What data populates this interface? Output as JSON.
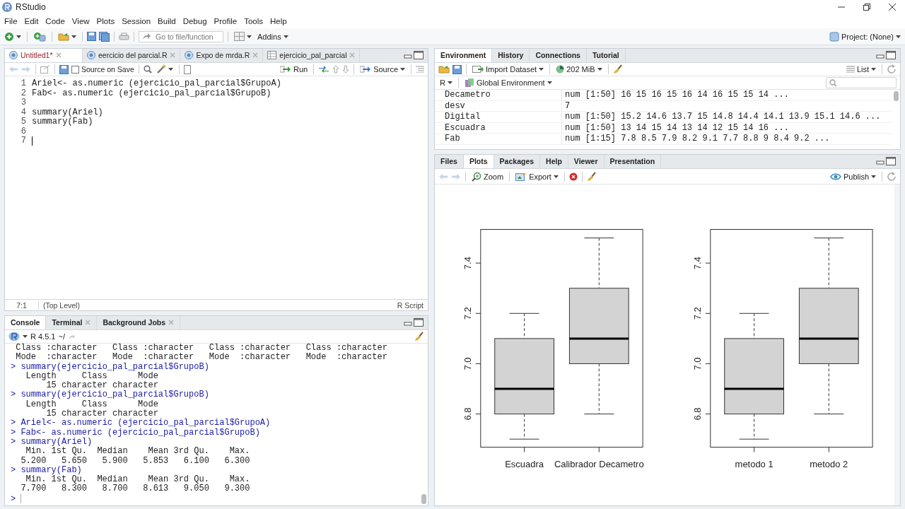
{
  "window": {
    "title": "RStudio"
  },
  "menu": [
    "File",
    "Edit",
    "Code",
    "View",
    "Plots",
    "Session",
    "Build",
    "Debug",
    "Profile",
    "Tools",
    "Help"
  ],
  "toolbar": {
    "goto_placeholder": "Go to file/function",
    "addins": "Addins",
    "project": "Project: (None)"
  },
  "editor": {
    "tabs": [
      {
        "label": "Untitled1*",
        "kind": "script",
        "selected": true,
        "modified": true
      },
      {
        "label": "eercicio del parcial.R",
        "kind": "script",
        "selected": false,
        "modified": false
      },
      {
        "label": "Expo de mrda.R",
        "kind": "script",
        "selected": false,
        "modified": false
      },
      {
        "label": "ejercicio_pal_parcial",
        "kind": "data",
        "selected": false,
        "modified": false
      }
    ],
    "source_on_save": {
      "label": "Source on Save",
      "checked": false
    },
    "run": "Run",
    "source": "Source",
    "lines": [
      {
        "number": "1",
        "code": "Ariel<- as.numeric (ejercicio_pal_parcial$GrupoA)"
      },
      {
        "number": "2",
        "code": "Fab<- as.numeric (ejercicio_pal_parcial$GrupoB)"
      },
      {
        "number": "3"
      },
      {
        "number": "4",
        "code": "summary(Ariel)"
      },
      {
        "number": "5",
        "code": "summary(Fab)"
      },
      {
        "number": "6"
      },
      {
        "number": "7",
        "cursor": true
      }
    ],
    "position": "7:1",
    "scope": "(Top Level)",
    "file_type": "R Script"
  },
  "console": {
    "tabs": [
      {
        "label": "Console",
        "selected": true,
        "closable": false
      },
      {
        "label": "Terminal",
        "selected": false,
        "closable": true
      },
      {
        "label": "Background Jobs",
        "selected": false,
        "closable": true
      }
    ],
    "version": "R 4.5.1",
    "path": "~/",
    "lines": [
      {
        "kind": "output",
        "text": " Class :character   Class :character   Class :character   Class :character"
      },
      {
        "kind": "output",
        "text": " Mode  :character   Mode  :character   Mode  :character   Mode  :character"
      },
      {
        "kind": "input",
        "prompt": ">",
        "text": "summary(ejercicio_pal_parcial$GrupoB)"
      },
      {
        "kind": "output",
        "text": "   Length     Class      Mode"
      },
      {
        "kind": "output",
        "text": "       15 character character"
      },
      {
        "kind": "input",
        "prompt": ">",
        "text": "summary(ejercicio_pal_parcial$GrupoB)"
      },
      {
        "kind": "output",
        "text": "   Length     Class      Mode"
      },
      {
        "kind": "output",
        "text": "       15 character character"
      },
      {
        "kind": "input",
        "prompt": ">",
        "text": "Ariel<- as.numeric (ejercicio_pal_parcial$GrupoA)"
      },
      {
        "kind": "input",
        "prompt": ">",
        "text": "Fab<- as.numeric (ejercicio_pal_parcial$GrupoB)"
      },
      {
        "kind": "input",
        "prompt": ">",
        "text": "summary(Ariel)"
      },
      {
        "kind": "output",
        "text": "   Min. 1st Qu.  Median    Mean 3rd Qu.    Max."
      },
      {
        "kind": "output",
        "text": "  5.200   5.650   5.900   5.853   6.100   6.300"
      },
      {
        "kind": "input",
        "prompt": ">",
        "text": "summary(Fab)"
      },
      {
        "kind": "output",
        "text": "   Min. 1st Qu.  Median    Mean 3rd Qu.    Max."
      },
      {
        "kind": "output",
        "text": "  7.700   8.300   8.700   8.613   9.050   9.300"
      },
      {
        "kind": "input",
        "prompt": ">",
        "cursor": true
      }
    ]
  },
  "environment": {
    "tabs": [
      {
        "label": "Environment",
        "selected": true
      },
      {
        "label": "History",
        "selected": false
      },
      {
        "label": "Connections",
        "selected": false
      },
      {
        "label": "Tutorial",
        "selected": false
      }
    ],
    "import": "Import Dataset",
    "memory": "202 MiB",
    "view": "List",
    "language": "R",
    "scope": "Global Environment",
    "rows": [
      {
        "name": "Decametro",
        "value": "num [1:50] 16 15 16 15 16 14 16 15 15 14 ..."
      },
      {
        "name": "desv",
        "value": "7"
      },
      {
        "name": "Digital",
        "value": "num [1:50] 15.2 14.6 13.7 15 14.8 14.4 14.1 13.9 15.1 14.6 ..."
      },
      {
        "name": "Escuadra",
        "value": "num [1:50] 13 14 15 14 13 14 12 15 14 16 ..."
      },
      {
        "name": "Fab",
        "value": "num [1:15] 7.8 8.5 7.9 8.2 9.1 7.7 8.8 9 8.4 9.2 ..."
      }
    ]
  },
  "plots": {
    "tabs": [
      {
        "label": "Files",
        "selected": false
      },
      {
        "label": "Plots",
        "selected": true
      },
      {
        "label": "Packages",
        "selected": false
      },
      {
        "label": "Help",
        "selected": false
      },
      {
        "label": "Viewer",
        "selected": false
      },
      {
        "label": "Presentation",
        "selected": false
      }
    ],
    "zoom": "Zoom",
    "export": "Export",
    "publish": "Publish",
    "charts": [
      {
        "categories": [
          "Escuadra",
          "Calibrador Decametro"
        ],
        "y_tick_labels": [
          "6.8",
          "7.0",
          "7.2",
          "7.4"
        ]
      },
      {
        "categories": [
          "metodo 1",
          "metodo 2"
        ],
        "y_tick_labels": [
          "6.8",
          "7.0",
          "7.2",
          "7.4"
        ]
      }
    ]
  }
}
